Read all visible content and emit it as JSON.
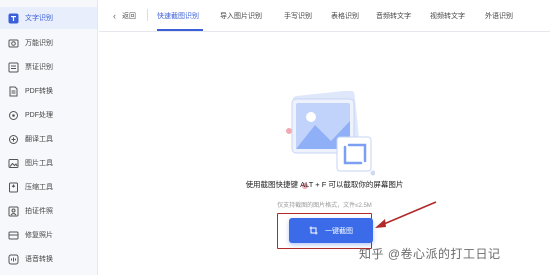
{
  "sidebar": {
    "items": [
      {
        "label": "文字识别",
        "icon": "text-recognition-icon",
        "active": true
      },
      {
        "label": "万能识别",
        "icon": "universal-scan-icon"
      },
      {
        "label": "票证识别",
        "icon": "ticket-icon"
      },
      {
        "label": "PDF转换",
        "icon": "pdf-convert-icon"
      },
      {
        "label": "PDF处理",
        "icon": "pdf-process-icon"
      },
      {
        "label": "翻译工具",
        "icon": "translate-icon"
      },
      {
        "label": "图片工具",
        "icon": "image-tool-icon"
      },
      {
        "label": "压缩工具",
        "icon": "compress-icon"
      },
      {
        "label": "拍证件照",
        "icon": "id-photo-icon"
      },
      {
        "label": "修复照片",
        "icon": "photo-repair-icon"
      },
      {
        "label": "语音转换",
        "icon": "voice-convert-icon"
      }
    ]
  },
  "topbar": {
    "back_label": "返回",
    "tabs": [
      {
        "label": "快速截图识别",
        "active": true
      },
      {
        "label": "导入图片识别"
      },
      {
        "label": "手写识别"
      },
      {
        "label": "表格识别"
      },
      {
        "label": "音频转文字"
      },
      {
        "label": "视频转文字"
      },
      {
        "label": "外语识别"
      }
    ]
  },
  "main": {
    "hint": "使用截图快捷键 ALT + F 可以截取你的屏幕图片",
    "subhint": "仅支持截图的图片格式，文件≤2.5M",
    "button_label": "一键截图"
  },
  "watermark": "知乎 @卷心派的打工日记",
  "colors": {
    "accent": "#3b6be8",
    "highlight_frame": "#b02a2a",
    "sidebar_bg": "#f7f8fb"
  }
}
